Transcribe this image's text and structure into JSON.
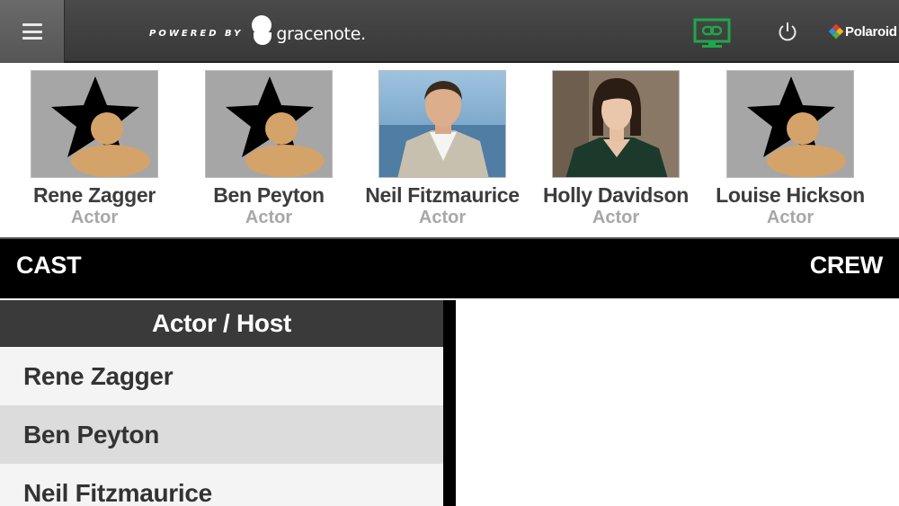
{
  "header": {
    "menu_icon": "hamburger-menu-icon",
    "powered_by": "POWERED BY",
    "provider": "gracenote.",
    "sync_icon": "screen-link-icon",
    "sync_color": "#1fa84a",
    "power_icon": "power-icon",
    "brand": "Polaroid"
  },
  "cast_strip": [
    {
      "name": "Rene Zagger",
      "role": "Actor",
      "photo": "placeholder"
    },
    {
      "name": "Ben Peyton",
      "role": "Actor",
      "photo": "placeholder"
    },
    {
      "name": "Neil Fitzmaurice",
      "role": "Actor",
      "photo": "portrait"
    },
    {
      "name": "Holly Davidson",
      "role": "Actor",
      "photo": "portrait"
    },
    {
      "name": "Louise Hickson",
      "role": "Actor",
      "photo": "placeholder"
    }
  ],
  "tabs": {
    "cast": "CAST",
    "crew": "CREW"
  },
  "list": {
    "header": "Actor / Host",
    "rows": [
      "Rene Zagger",
      "Ben Peyton",
      "Neil Fitzmaurice"
    ]
  }
}
